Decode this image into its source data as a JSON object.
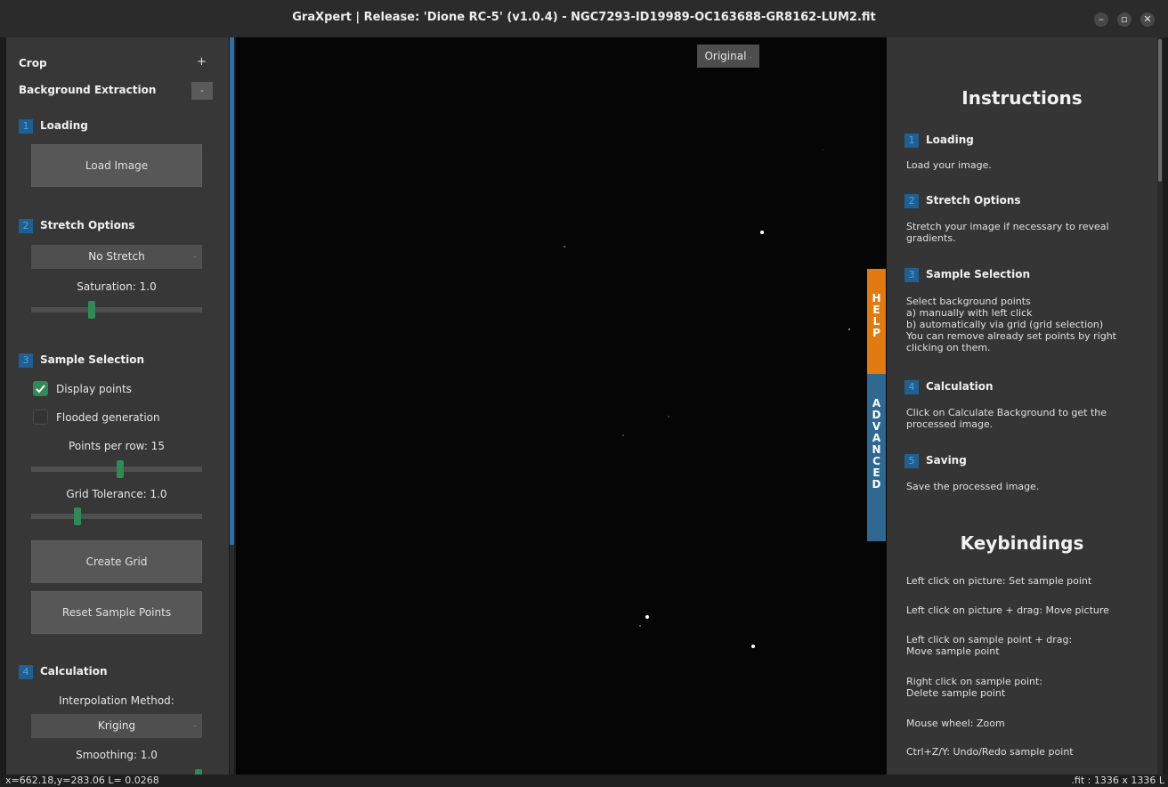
{
  "window": {
    "title": "GraXpert | Release: 'Dione RC-5' (v1.0.4) - NGC7293-ID19989-OC163688-GR8162-LUM2.fit",
    "minimize": "–",
    "maximize": "▫",
    "close": "✕"
  },
  "left_panel": {
    "crop_label": "Crop",
    "crop_toggle": "+",
    "bg_label": "Background Extraction",
    "bg_toggle": "-",
    "loading": {
      "num": "1",
      "title": "Loading",
      "button": "Load Image"
    },
    "stretch": {
      "num": "2",
      "title": "Stretch Options",
      "selected": "No Stretch",
      "saturation_label": "Saturation: 1.0",
      "saturation_level": 0.35
    },
    "sample": {
      "num": "3",
      "title": "Sample Selection",
      "display_points": "Display points",
      "display_points_checked": true,
      "flooded": "Flooded generation",
      "flooded_checked": false,
      "points_label": "Points per row: 15",
      "points_level": 0.52,
      "tolerance_label": "Grid Tolerance: 1.0",
      "tolerance_level": 0.26,
      "create_grid": "Create Grid",
      "reset_points": "Reset Sample Points"
    },
    "calc": {
      "num": "4",
      "title": "Calculation",
      "method_label": "Interpolation Method:",
      "method": "Kriging",
      "smoothing_label": "Smoothing: 1.0"
    }
  },
  "canvas": {
    "view_selector": "Original"
  },
  "tabs": {
    "help": "H\nE\nL\nP",
    "advanced": "A\nD\nV\nA\nN\nC\nE\nD",
    "help_color": "#e07b12",
    "advanced_color": "#2f6891"
  },
  "instructions": {
    "heading": "Instructions",
    "steps": [
      {
        "num": "1",
        "title": "Loading",
        "text": "Load your image."
      },
      {
        "num": "2",
        "title": "Stretch Options",
        "text": "Stretch your image if necessary to reveal\ngradients."
      },
      {
        "num": "3",
        "title": "Sample Selection",
        "text": "Select background points\n   a) manually with left click\n   b) automatically via grid (grid selection)\nYou can remove already set points by right\nclicking on them."
      },
      {
        "num": "4",
        "title": "Calculation",
        "text": "Click on Calculate Background to get the\nprocessed image."
      },
      {
        "num": "5",
        "title": "Saving",
        "text": "Save the processed image."
      }
    ]
  },
  "keybindings": {
    "heading": "Keybindings",
    "items": [
      "Left click on picture: Set sample point",
      "Left click on picture + drag: Move picture",
      "Left click on sample point + drag:\nMove sample point",
      "Right click on sample point:\nDelete sample point",
      "Mouse wheel: Zoom",
      "Ctrl+Z/Y: Undo/Redo sample point"
    ]
  },
  "status": {
    "coords": "x=662.18,y=283.06  L= 0.0268",
    "image_info": ".fit : 1336 x 1336 L"
  }
}
